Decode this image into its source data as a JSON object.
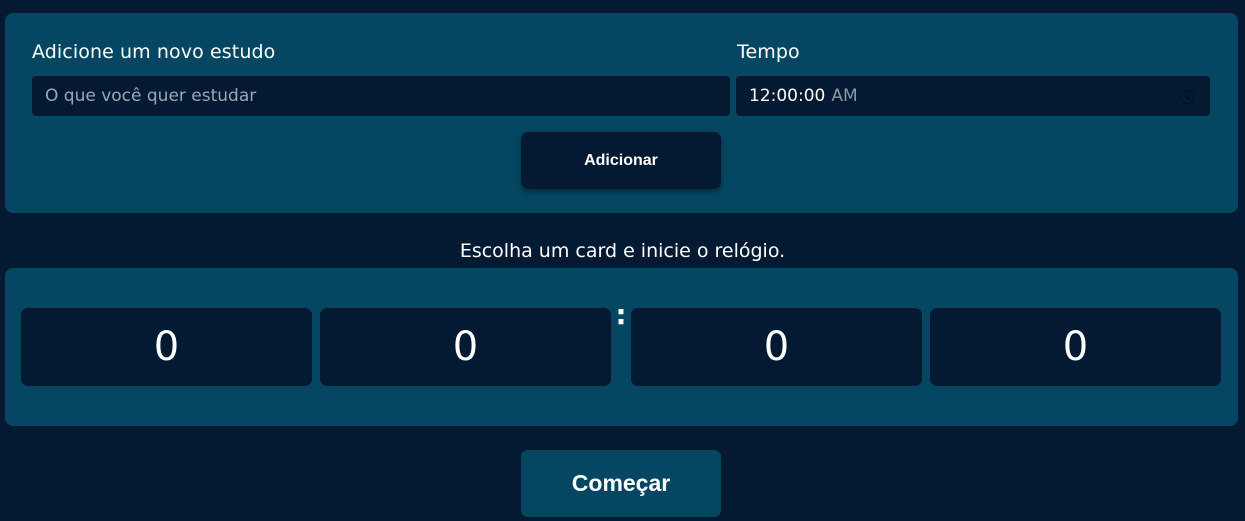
{
  "form": {
    "study_label": "Adicione um novo estudo",
    "study_placeholder": "O que você quer estudar",
    "time_label": "Tempo",
    "time_value": "12:00:00",
    "time_ampm": "AM",
    "add_label": "Adicionar"
  },
  "instruction": "Escolha um card e inicie o relógio.",
  "timer": {
    "digits": [
      "0",
      "0",
      "0",
      "0"
    ],
    "separator": ":"
  },
  "start_label": "Começar",
  "colors": {
    "background": "#041a32",
    "panel": "#054763"
  },
  "icons": {
    "time_picker": "clock-icon"
  }
}
